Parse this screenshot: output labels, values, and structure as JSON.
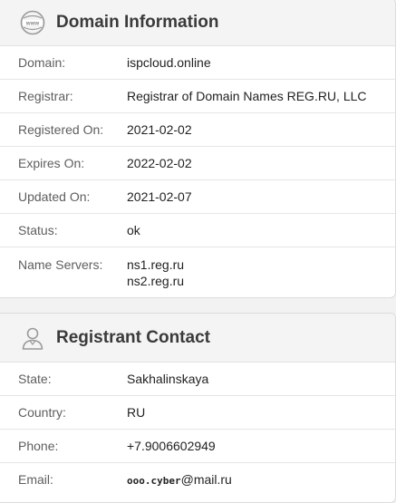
{
  "domain_section": {
    "title": "Domain Information",
    "icon": "www-globe-icon",
    "rows": [
      {
        "label": "Domain:",
        "value": "ispcloud.online"
      },
      {
        "label": "Registrar:",
        "value": "Registrar of Domain Names REG.RU, LLC"
      },
      {
        "label": "Registered On:",
        "value": "2021-02-02"
      },
      {
        "label": "Expires On:",
        "value": "2022-02-02"
      },
      {
        "label": "Updated On:",
        "value": "2021-02-07"
      },
      {
        "label": "Status:",
        "value": "ok"
      },
      {
        "label": "Name Servers:",
        "values": [
          "ns1.reg.ru",
          "ns2.reg.ru"
        ]
      }
    ]
  },
  "registrant_section": {
    "title": "Registrant Contact",
    "icon": "person-icon",
    "rows": [
      {
        "label": "State:",
        "value": "Sakhalinskaya"
      },
      {
        "label": "Country:",
        "value": "RU"
      },
      {
        "label": "Phone:",
        "value": "+7.9006602949"
      },
      {
        "label": "Email:",
        "value_image_part": "ooo.cyber",
        "value_text_part": "@mail.ru"
      }
    ]
  }
}
